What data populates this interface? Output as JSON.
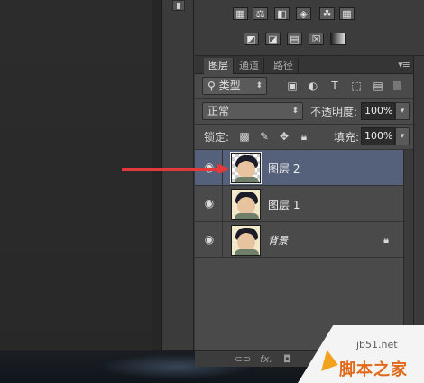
{
  "layers_panel": {
    "tabs": [
      "图层",
      "通道",
      "路径"
    ],
    "filter_label": "类型",
    "blend_mode": "正常",
    "opacity_label": "不透明度:",
    "opacity_value": "100%",
    "lock_label": "锁定:",
    "fill_label": "填充:",
    "fill_value": "100%",
    "layers": [
      {
        "name": "图层 2",
        "selected": true
      },
      {
        "name": "图层 1",
        "selected": false
      },
      {
        "name": "背景",
        "selected": false
      }
    ]
  },
  "footer": {
    "fx": "fx."
  },
  "watermark": {
    "url": "jb51.net",
    "text": "脚本之家"
  },
  "colors": {
    "selected_row": "#55617a",
    "arrow": "#e23a3a",
    "watermark_text": "#e06a1a"
  }
}
